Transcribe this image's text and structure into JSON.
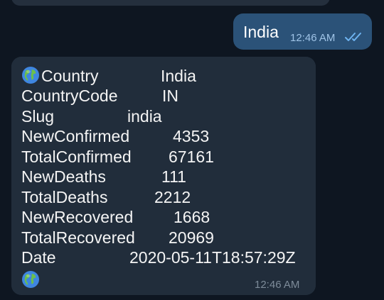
{
  "outgoing": {
    "text": "India",
    "time": "12:46 AM",
    "status_icon": "double-check-icon"
  },
  "incoming": {
    "time": "12:46 AM",
    "icon": "globe-icon",
    "rows": [
      {
        "key": "Country",
        "value": "India"
      },
      {
        "key": "CountryCode",
        "value": "IN"
      },
      {
        "key": "Slug",
        "value": "india"
      },
      {
        "key": "NewConfirmed",
        "value": "4353"
      },
      {
        "key": "TotalConfirmed",
        "value": "67161"
      },
      {
        "key": "NewDeaths",
        "value": "111"
      },
      {
        "key": "TotalDeaths",
        "value": "2212"
      },
      {
        "key": "NewRecovered",
        "value": "1668"
      },
      {
        "key": "TotalRecovered",
        "value": "20969"
      },
      {
        "key": "Date",
        "value": "2020-05-11T18:57:29Z"
      }
    ]
  },
  "colors": {
    "background": "#0e1621",
    "incoming_bubble": "#212d3b",
    "outgoing_bubble": "#2b5278",
    "check_color": "#6eb3f0"
  }
}
